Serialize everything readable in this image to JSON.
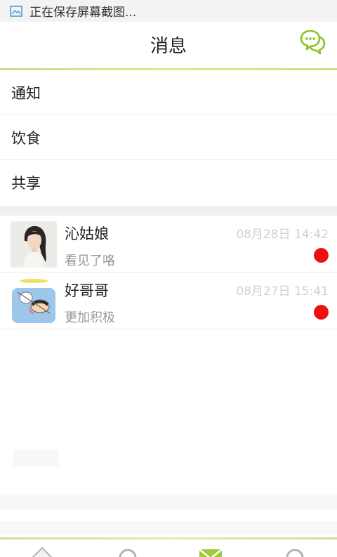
{
  "status_bar": {
    "text": "正在保存屏幕截图..."
  },
  "header": {
    "title": "消息"
  },
  "menu": [
    {
      "label": "通知"
    },
    {
      "label": "饮食"
    },
    {
      "label": "共享"
    }
  ],
  "messages": [
    {
      "name": "沁姑娘",
      "time": "08月28日 14:42",
      "preview": "看见了咯",
      "unread": true
    },
    {
      "name": "好哥哥",
      "time": "08月27日 15:41",
      "preview": "更加积极",
      "unread": true
    }
  ],
  "colors": {
    "accent": "#8dc21f",
    "unread": "#ee1010",
    "tab_active": "#9ccc3c"
  },
  "icons": {
    "header_right": "chat-bubbles-icon",
    "status": "screenshot-icon"
  }
}
